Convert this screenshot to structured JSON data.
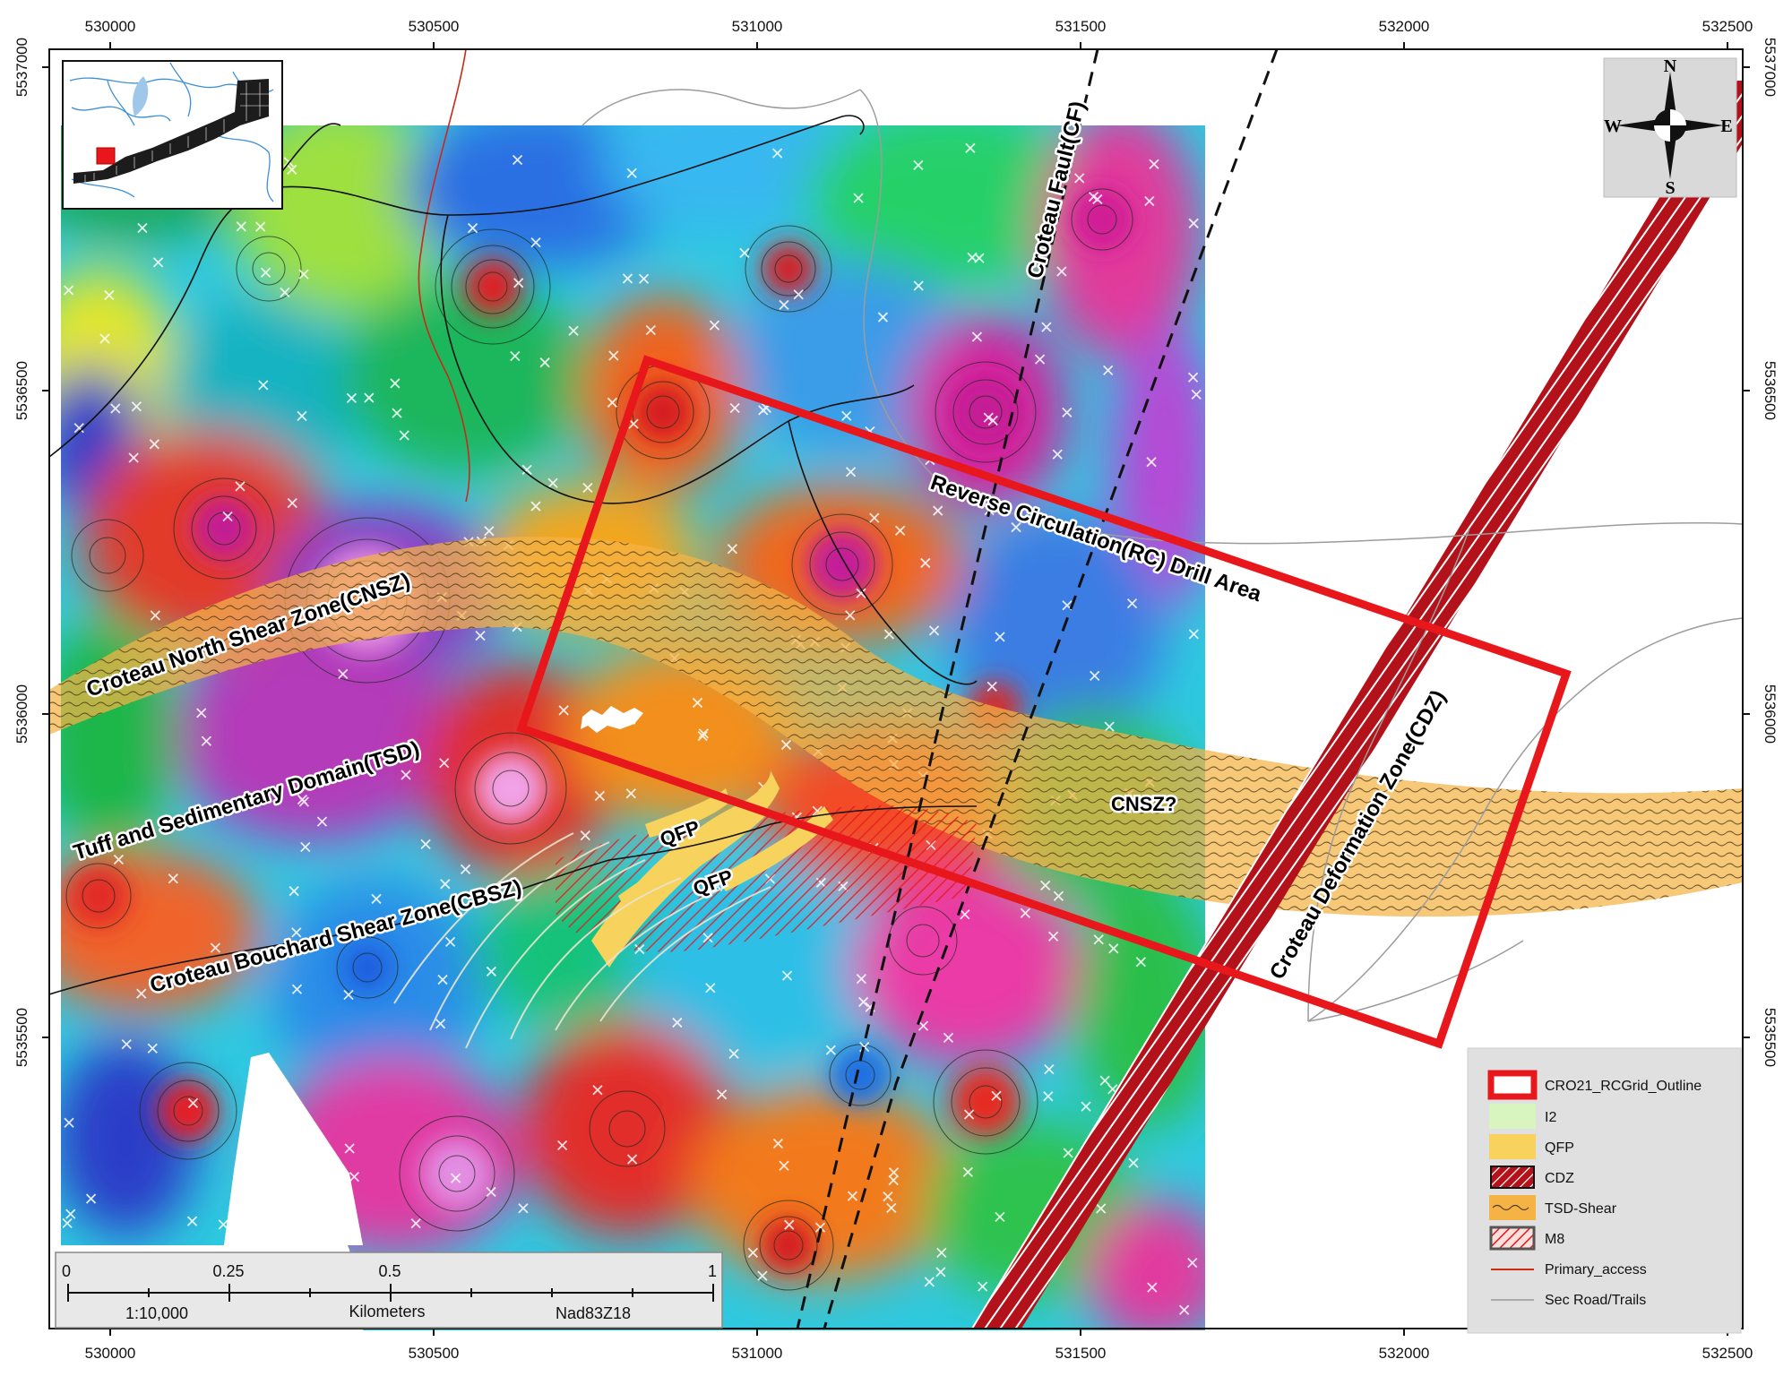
{
  "coords": {
    "x_ticks": [
      "530000",
      "530500",
      "531000",
      "531500",
      "532000",
      "532500"
    ],
    "y_ticks": [
      "5537000",
      "5536500",
      "5536000",
      "5535500"
    ]
  },
  "labels": {
    "cnsz": "Croteau North Shear Zone(CNSZ)",
    "tsd": "Tuff and Sedimentary Domain(TSD)",
    "cbsz": "Croteau Bouchard Shear Zone(CBSZ)",
    "rc_area": "Reverse Circulation(RC) Drill Area",
    "fault": "Croteau Fault(CF)",
    "cdz": "Croteau Deformation Zone(CDZ)",
    "cnsz_q": "CNSZ?",
    "qfp1": "QFP",
    "qfp2": "QFP"
  },
  "compass": {
    "n": "N",
    "s": "S",
    "e": "E",
    "w": "W"
  },
  "legend": {
    "items": [
      {
        "label": "CRO21_RCGrid_Outline",
        "color": "#e8171c"
      },
      {
        "label": "I2",
        "color": "#d8f5c0"
      },
      {
        "label": "QFP",
        "color": "#f7d25c"
      },
      {
        "label": "CDZ",
        "color": "#c8151a"
      },
      {
        "label": "TSD-Shear",
        "color": "#f5b345"
      },
      {
        "label": "M8",
        "color": "#e8171c"
      },
      {
        "label": "Primary_access",
        "color": "#d02a10"
      },
      {
        "label": "Sec Road/Trails",
        "color": "#999999"
      }
    ]
  },
  "scalebar": {
    "ticks": [
      "0",
      "0.25",
      "0.5",
      "1"
    ],
    "ratio": "1:10,000",
    "units": "Kilometers",
    "datum": "Nad83Z18"
  }
}
